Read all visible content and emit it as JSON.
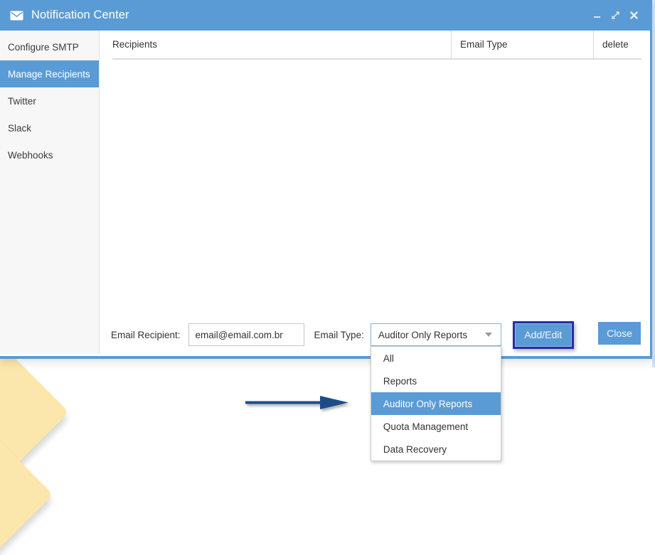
{
  "window": {
    "title": "Notification Center",
    "icon": "envelope-icon",
    "controls": {
      "minimize": "minimize-icon",
      "maximize": "maximize-icon",
      "close": "close-icon"
    },
    "accent_color": "#5b9bd5"
  },
  "sidebar": {
    "items": [
      {
        "label": "Configure SMTP",
        "active": false
      },
      {
        "label": "Manage Recipients",
        "active": true
      },
      {
        "label": "Twitter",
        "active": false
      },
      {
        "label": "Slack",
        "active": false
      },
      {
        "label": "Webhooks",
        "active": false
      }
    ]
  },
  "table": {
    "columns": [
      "Recipients",
      "Email Type",
      "delete"
    ],
    "rows": []
  },
  "form": {
    "email_recipient_label": "Email Recipient:",
    "email_recipient_value": "email@email.com.br",
    "email_recipient_placeholder": "email@email.com.br",
    "email_type_label": "Email Type:",
    "email_type_value": "Auditor Only Reports",
    "email_type_options": [
      "All",
      "Reports",
      "Auditor Only Reports",
      "Quota Management",
      "Data Recovery"
    ],
    "email_type_selected_index": 2,
    "add_edit_label": "Add/Edit",
    "close_label": "Close",
    "focus_ring_color": "#2a2aad"
  },
  "annotation": {
    "arrow_color": "#1f4e88",
    "note_color": "#fbe7ab"
  }
}
